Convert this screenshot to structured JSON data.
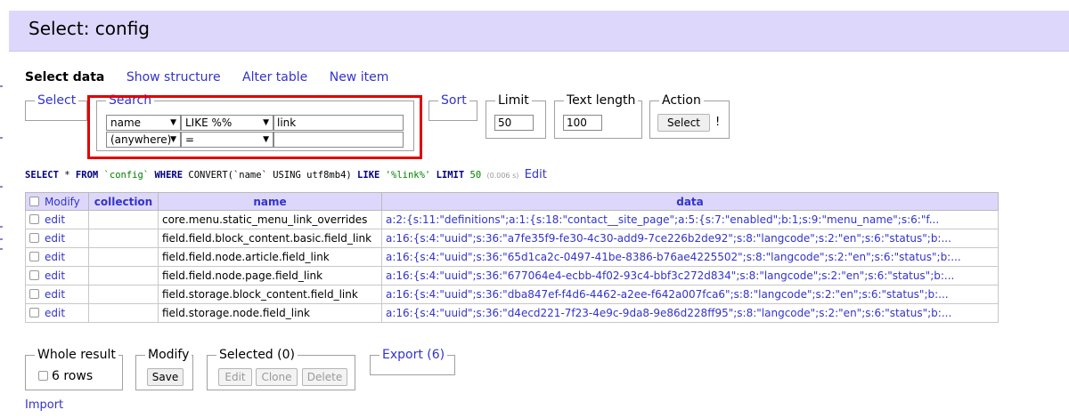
{
  "header": {
    "title": "Select: config"
  },
  "nav": {
    "current": "Select data",
    "links": [
      "Show structure",
      "Alter table",
      "New item"
    ]
  },
  "panels": {
    "select_legend": "Select",
    "search_legend": "Search",
    "search_rows": [
      {
        "column": "name",
        "operator": "LIKE %%",
        "value": "link"
      },
      {
        "column": "(anywhere)",
        "operator": "=",
        "value": ""
      }
    ],
    "sort_legend": "Sort",
    "limit_legend": "Limit",
    "limit_value": "50",
    "text_length_legend": "Text length",
    "text_length_value": "100",
    "action_legend": "Action",
    "action_button": "Select",
    "action_suffix": "!"
  },
  "query": {
    "select_kw": "SELECT",
    "star": "*",
    "from_kw": "FROM",
    "table": "`config`",
    "where_kw": "WHERE",
    "convert": "CONVERT(`name` USING utf8mb4)",
    "like_kw": "LIKE",
    "pattern": "'%link%'",
    "limit_kw": "LIMIT",
    "limit": "50",
    "time": "(0.006 s)",
    "edit": "Edit"
  },
  "table": {
    "headers": {
      "modify": "Modify",
      "collection": "collection",
      "name": "name",
      "data": "data"
    },
    "rows": [
      {
        "action": "edit",
        "collection": "",
        "name": "core.menu.static_menu_link_overrides",
        "data": "a:2:{s:11:\"definitions\";a:1:{s:18:\"contact__site_page\";a:5:{s:7:\"enabled\";b:1;s:9:\"menu_name\";s:6:\"f..."
      },
      {
        "action": "edit",
        "collection": "",
        "name": "field.field.block_content.basic.field_link",
        "data": "a:16:{s:4:\"uuid\";s:36:\"a7fe35f9-fe30-4c30-add9-7ce226b2de92\";s:8:\"langcode\";s:2:\"en\";s:6:\"status\";b:..."
      },
      {
        "action": "edit",
        "collection": "",
        "name": "field.field.node.article.field_link",
        "data": "a:16:{s:4:\"uuid\";s:36:\"65d1ca2c-0497-41be-8386-b76ae4225502\";s:8:\"langcode\";s:2:\"en\";s:6:\"status\";b:..."
      },
      {
        "action": "edit",
        "collection": "",
        "name": "field.field.node.page.field_link",
        "data": "a:16:{s:4:\"uuid\";s:36:\"677064e4-ecbb-4f02-93c4-bbf3c272d834\";s:8:\"langcode\";s:2:\"en\";s:6:\"status\";b:..."
      },
      {
        "action": "edit",
        "collection": "",
        "name": "field.storage.block_content.field_link",
        "data": "a:16:{s:4:\"uuid\";s:36:\"dba847ef-f4d6-4462-a2ee-f642a007fca6\";s:8:\"langcode\";s:2:\"en\";s:6:\"status\";b:..."
      },
      {
        "action": "edit",
        "collection": "",
        "name": "field.storage.node.field_link",
        "data": "a:16:{s:4:\"uuid\";s:36:\"d4ecd221-7f23-4e9c-9da8-9e86d228ff95\";s:8:\"langcode\";s:2:\"en\";s:6:\"status\";b:..."
      }
    ]
  },
  "footer": {
    "whole_result_legend": "Whole result",
    "rows_label": "6 rows",
    "modify_legend": "Modify",
    "save_button": "Save",
    "selected_legend": "Selected (0)",
    "edit_button": "Edit",
    "clone_button": "Clone",
    "delete_button": "Delete",
    "export_legend": "Export (6)",
    "import_link": "Import"
  }
}
